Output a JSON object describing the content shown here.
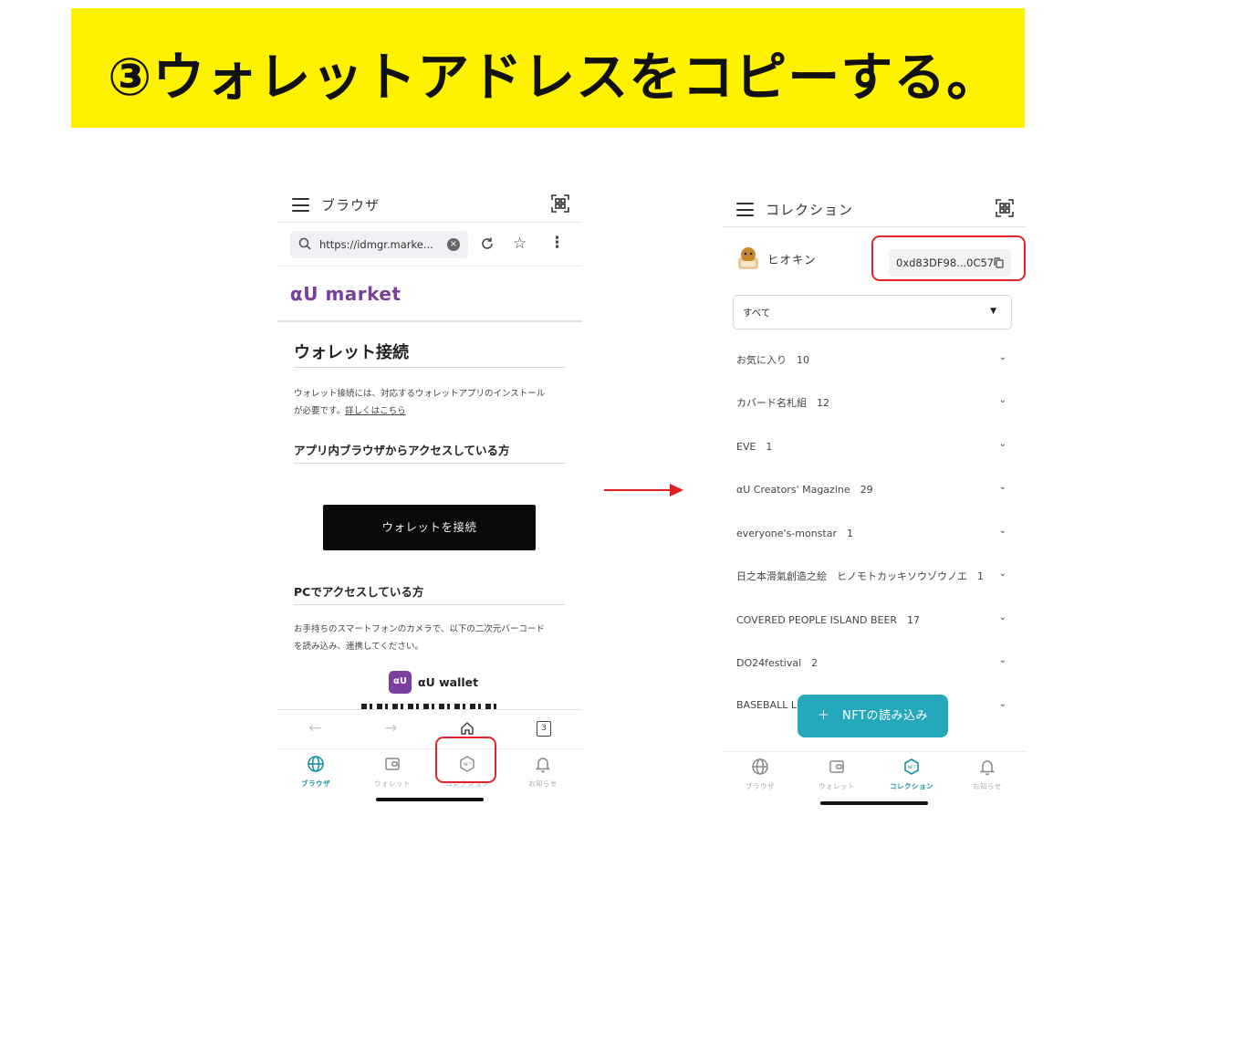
{
  "banner": {
    "title": "③ウォレットアドレスをコピーする。"
  },
  "left_phone": {
    "title": "ブラウザ",
    "url": "https://idmgr.marke...",
    "brand": "αU market",
    "wallet_connect": {
      "title": "ウォレット接続",
      "desc_line1": "ウォレット接続には、対応するウォレットアプリのインストール",
      "desc_line2": "が必要です。",
      "desc_link": "詳しくはこちら",
      "in_app_title": "アプリ内ブラウザからアクセスしている方",
      "connect_button": "ウォレットを接続",
      "pc_title": "PCでアクセスしている方",
      "pc_desc_line1": "お手持ちのスマートフォンのカメラで、以下の二次元バーコード",
      "pc_desc_line2": "を読み込み、連携してください。",
      "wallet_logo": "αU",
      "wallet_name": "αU wallet"
    },
    "tab_count": "3",
    "bottom_nav": [
      "ブラウザ",
      "ウォレット",
      "コレクション",
      "お知らせ"
    ],
    "active_tab": "ブラウザ"
  },
  "right_phone": {
    "title": "コレクション",
    "user_name": "ヒオキン",
    "wallet_address": "0xd83DF98...0C57",
    "filter": "すべて",
    "collections": [
      "お気に入り　10",
      "カバード名札組　12",
      "EVE　1",
      "αU Creators' Magazine　29",
      "everyone's-monstar　1",
      "日之本滑氣創造之絵　ヒノモトカッキソウゾウノエ　1",
      "COVERED PEOPLE ISLAND BEER　17",
      "DO24festival　2",
      "BASEBALL L"
    ],
    "fab_label": "＋　NFTの読み込み",
    "bottom_nav": [
      "ブラウザ",
      "ウォレット",
      "コレクション",
      "お知らせ"
    ],
    "active_tab": "コレクション"
  },
  "colors": {
    "banner": "#fff200",
    "highlight": "#e52328",
    "accent": "#25a8bc",
    "brand": "#7a3f98"
  },
  "icons": [
    "menu-icon",
    "qr-scan-icon",
    "search-icon",
    "clear-icon",
    "reload-icon",
    "star-icon",
    "more-icon",
    "home-icon",
    "globe-icon",
    "wallet-icon",
    "nft-icon",
    "bell-icon",
    "copy-icon",
    "chevron-down-icon",
    "plus-icon"
  ]
}
